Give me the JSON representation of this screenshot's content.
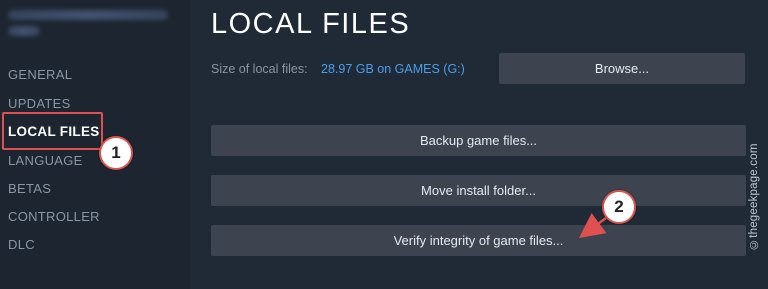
{
  "sidebar": {
    "items": [
      {
        "label": "GENERAL"
      },
      {
        "label": "UPDATES"
      },
      {
        "label": "LOCAL FILES"
      },
      {
        "label": "LANGUAGE"
      },
      {
        "label": "BETAS"
      },
      {
        "label": "CONTROLLER"
      },
      {
        "label": "DLC"
      }
    ],
    "active_index": 2
  },
  "main": {
    "title": "LOCAL FILES",
    "size_label": "Size of local files:",
    "size_value": "28.97 GB on GAMES (G:)",
    "browse_button": "Browse...",
    "backup_button": "Backup game files...",
    "move_button": "Move install folder...",
    "verify_button": "Verify integrity of game files..."
  },
  "annotations": {
    "step1": "1",
    "step2": "2",
    "highlight_color": "#e05050"
  },
  "watermark": "©thegeekpage.com",
  "colors": {
    "background": "#1f2a36",
    "sidebar": "#1d2630",
    "button": "#3d4450",
    "link": "#4b9ee8"
  }
}
